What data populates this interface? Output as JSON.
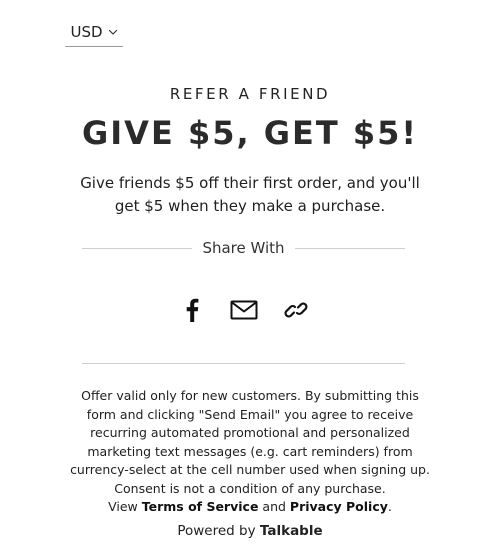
{
  "currency": {
    "selected": "USD",
    "icon": "chevron-down-icon"
  },
  "header": {
    "kicker": "REFER A FRIEND",
    "headline": "GIVE $5, GET $5!",
    "description_line1": "Give friends $5 off their first order, and you'll",
    "description_line2": "get $5 when they make a purchase."
  },
  "share": {
    "label": "Share With",
    "icons": [
      "facebook-icon",
      "email-icon",
      "link-icon"
    ]
  },
  "disclaimer": {
    "line1": "Offer valid only for new customers. By submitting this",
    "line2": "form and clicking \"Send Email\" you agree to receive",
    "line3": "recurring automated promotional and personalized",
    "line4": "marketing text messages (e.g. cart reminders) from",
    "line5": "currency-select at the cell number used when signing up.",
    "line6": "Consent is not a condition of any purchase.",
    "view_prefix": "View",
    "terms_link": "Terms of Service",
    "and_text": "and",
    "privacy_link": "Privacy Policy",
    "end_period": "."
  },
  "footer": {
    "powered_prefix": "Powered by",
    "brand": "Talkable"
  }
}
